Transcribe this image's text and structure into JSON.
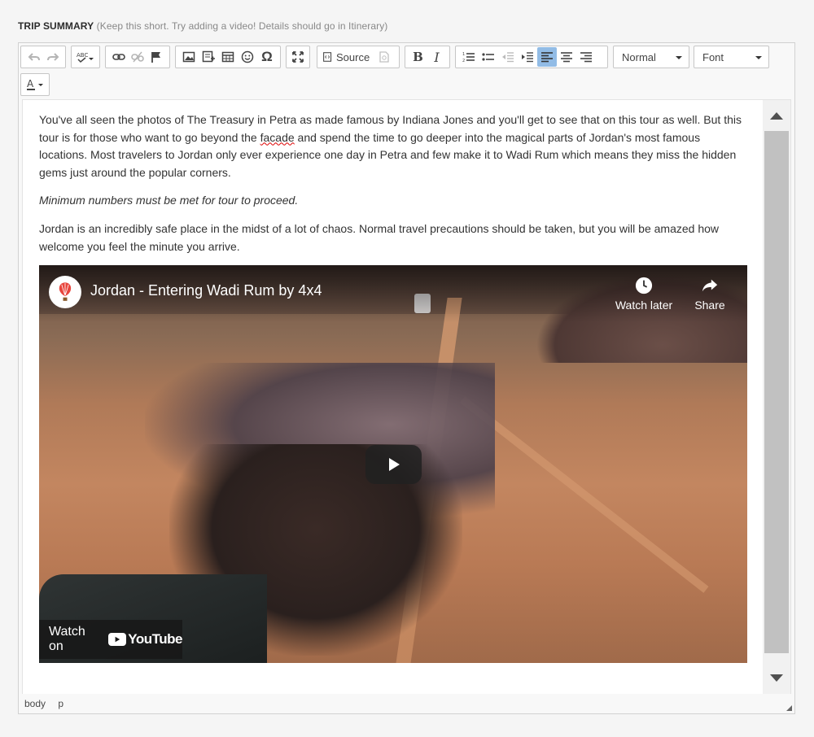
{
  "field": {
    "label": "TRIP SUMMARY",
    "hint": "(Keep this short. Try adding a video! Details should go in Itinerary)"
  },
  "toolbar": {
    "source_label": "Source",
    "format_value": "Normal",
    "font_value": "Font",
    "bold": "B",
    "italic": "I",
    "omega": "Ω"
  },
  "content": {
    "p1_before": "You've all seen the photos of The Treasury in Petra as made famous by Indiana Jones and you'll get to see that on this tour as well. But this tour is for those who want to go beyond the ",
    "p1_misspelled": "facade",
    "p1_after": " and spend the time to go deeper into the magical parts of Jordan's most famous locations. Most travelers to Jordan only ever experience one day in Petra and few make it to Wadi Rum which means they miss the hidden gems just around the popular corners.",
    "p2": "Minimum numbers must be met for tour to proceed.",
    "p3": "Jordan is an incredibly safe place in the midst of a lot of chaos. Normal travel precautions should be taken, but you will be amazed how welcome you feel the minute you arrive."
  },
  "video": {
    "title": "Jordan - Entering Wadi Rum by 4x4",
    "watch_later": "Watch later",
    "share": "Share",
    "watch_on": "Watch on",
    "youtube": "YouTube"
  },
  "statusbar": {
    "path": [
      "body",
      "p"
    ]
  },
  "colors": {
    "active_button": "#92bce6",
    "youtube_red": "#ff0000"
  }
}
